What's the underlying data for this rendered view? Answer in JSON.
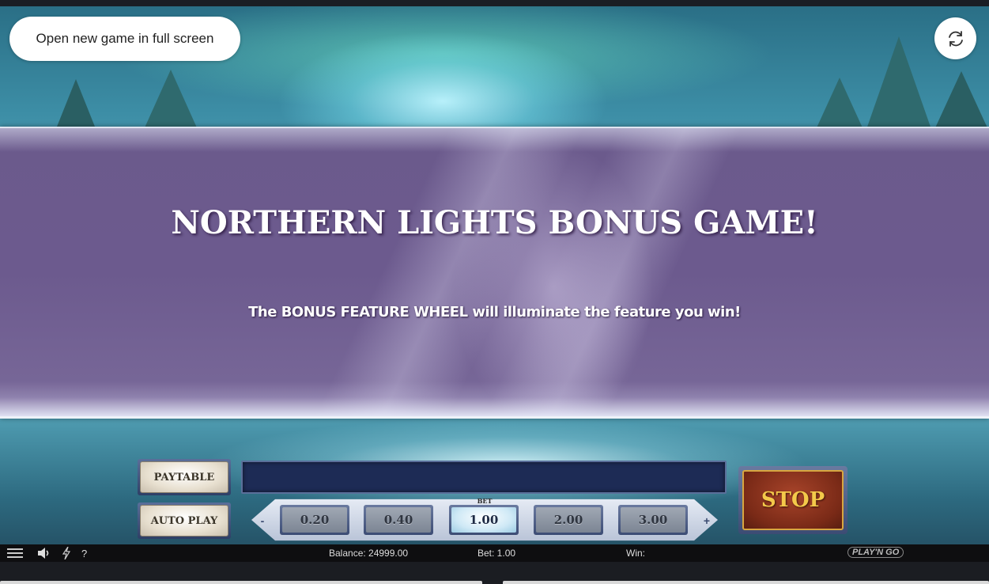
{
  "overlay": {
    "fullscreen_label": "Open new game in full screen",
    "reload_icon": "reload-icon"
  },
  "banner": {
    "title": "NORTHERN LIGHTS BONUS GAME!",
    "subtitle": "The BONUS FEATURE WHEEL will illuminate the feature you win!"
  },
  "controls": {
    "paytable_label": "PAYTABLE",
    "autoplay_label": "AUTO PLAY",
    "bet_caption": "BET",
    "bet_options": [
      "0.20",
      "0.40",
      "1.00",
      "2.00",
      "3.00"
    ],
    "selected_bet": "1.00",
    "decrease_symbol": "-",
    "increase_symbol": "+",
    "stop_label": "STOP"
  },
  "statusbar": {
    "help_symbol": "?",
    "balance": "Balance: 24999.00",
    "bet": "Bet: 1.00",
    "win": "Win:",
    "brand": "PLAY'N GO"
  },
  "colors": {
    "banner": "#6b5a8c",
    "stop_text": "#f4c94a",
    "message_bar": "#1d2b55"
  }
}
